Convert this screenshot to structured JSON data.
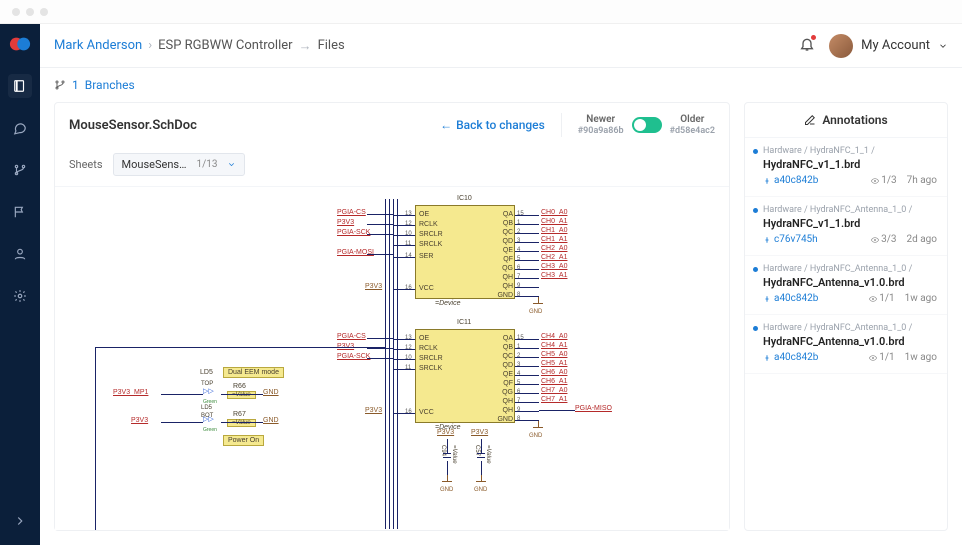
{
  "breadcrumb": {
    "user": "Mark Anderson",
    "project": "ESP RGBWW Controller",
    "page": "Files"
  },
  "account_label": "My Account",
  "branches": {
    "count": "1",
    "label": "Branches"
  },
  "document": {
    "title": "MouseSensor.SchDoc",
    "back_label": "Back to changes",
    "newer_label": "Newer",
    "newer_hash": "#90a9a86b",
    "older_label": "Older",
    "older_hash": "#d58e4ac2",
    "sheets_label": "Sheets",
    "sheet_name": "MouseSens…",
    "sheet_count": "1/13"
  },
  "annotations": {
    "title": "Annotations",
    "items": [
      {
        "path": "Hardware / HydraNFC_1_1 /",
        "file": "HydraNFC_v1_1.brd",
        "hash": "a40c842b",
        "count": "1/3",
        "time": "7h ago"
      },
      {
        "path": "Hardware / HydraNFC_Antenna_1_0 /",
        "file": "HydraNFC_v1_1.brd",
        "hash": "c76v745h",
        "count": "3/3",
        "time": "2d ago"
      },
      {
        "path": "Hardware / HydraNFC_Antenna_1_0 /",
        "file": "HydraNFC_Antenna_v1.0.brd",
        "hash": "a40c842b",
        "count": "1/1",
        "time": "1w ago"
      },
      {
        "path": "Hardware / HydraNFC_Antenna_1_0 /",
        "file": "HydraNFC_Antenna_v1.0.brd",
        "hash": "a40c842b",
        "count": "1/1",
        "time": "1w ago"
      }
    ]
  },
  "schematic": {
    "ic_top_ref": "IC10",
    "ic_bot_ref": "IC11",
    "device_label": "=Device",
    "pins_left": [
      "OE",
      "RCLK",
      "SRCLR",
      "SRCLK",
      "SER",
      "VCC"
    ],
    "pins_right": [
      "QA",
      "QB",
      "QC",
      "QD",
      "QE",
      "QF",
      "QG",
      "QH",
      "QH",
      "GND"
    ],
    "nets_left_top": [
      "PGIA-CS",
      "P3V3",
      "PGIA-SCK",
      "PGIA-MOSI"
    ],
    "nets_left_bot": [
      "PGIA-CS",
      "P3V3",
      "PGIA-SCK"
    ],
    "p3v3_label": "P3V3",
    "gnd_label": "GND",
    "ch_nets_top": [
      "CH0_A0",
      "CH0_A1",
      "CH1_A0",
      "CH1_A1",
      "CH2_A0",
      "CH2_A1",
      "CH3_A0",
      "CH3_A1"
    ],
    "ch_nets_bot": [
      "CH4_A0",
      "CH4_A1",
      "CH5_A0",
      "CH5_A1",
      "CH6_A0",
      "CH6_A1",
      "CH7_A0",
      "CH7_A1"
    ],
    "pgia_miso": "PGIA-MISO",
    "c_refs": [
      "C94",
      "C57"
    ],
    "led_block": {
      "ld5": "LD5",
      "dual": "Dual EEM mode",
      "top": "TOP",
      "p3v3_mp1": "P3V3_MP1",
      "r66": "R66",
      "r67": "R67",
      "bot": "BOT",
      "power_on": "Power On",
      "gnd": "GND",
      "p3v3": "P3V3",
      "value": "=Value",
      "green": "Green"
    }
  }
}
